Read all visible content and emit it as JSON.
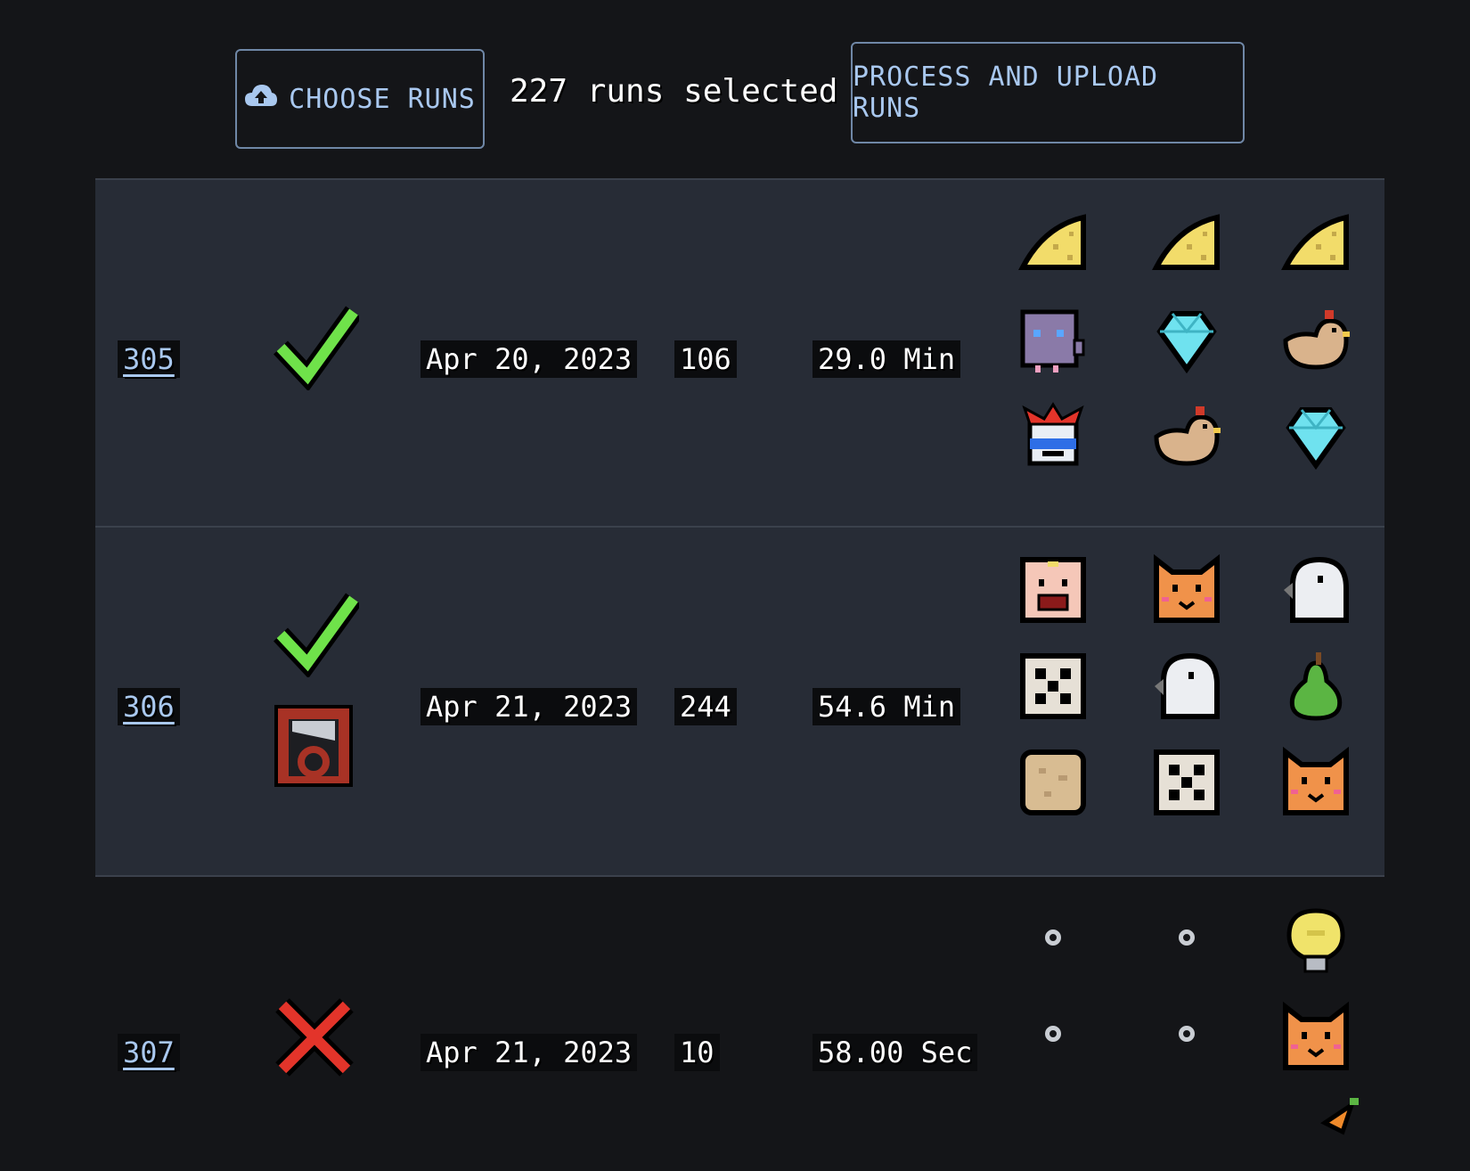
{
  "toolbar": {
    "choose_label": "CHOOSE RUNS",
    "selected_text": "227 runs selected",
    "upload_label": "PROCESS AND UPLOAD RUNS"
  },
  "colors": {
    "background": "#141518",
    "row_alt": "#272c36",
    "accent_text": "#a9c8ef",
    "win": "#6fe24a",
    "loss": "#e3342a"
  },
  "runs": [
    {
      "id": "305",
      "status": "win",
      "date": "Apr 20, 2023",
      "score": "106",
      "duration": "29.0 Min",
      "items": [
        "cheese-icon",
        "cheese-icon",
        "cheese-icon",
        "rat-icon",
        "diamond-icon",
        "chicken-icon",
        "jester-icon",
        "chicken-icon",
        "diamond-icon"
      ]
    },
    {
      "id": "306",
      "status": "win",
      "status_extra": "guillotine",
      "date": "Apr 21, 2023",
      "score": "244",
      "duration": "54.6 Min",
      "items": [
        "baby-face-icon",
        "cat-icon",
        "ghost-icon",
        "dice-icon",
        "ghost-icon",
        "pear-icon",
        "cookie-icon",
        "dice-icon",
        "cat-icon"
      ]
    },
    {
      "id": "307",
      "status": "loss",
      "date": "Apr 21, 2023",
      "score": "10",
      "duration": "58.00 Sec",
      "items": [
        "empty-slot-icon",
        "empty-slot-icon",
        "lightbulb-icon",
        "empty-slot-icon",
        "empty-slot-icon",
        "cat-icon",
        "empty-slot-icon",
        "empty-slot-icon",
        "carrot-icon"
      ]
    }
  ]
}
